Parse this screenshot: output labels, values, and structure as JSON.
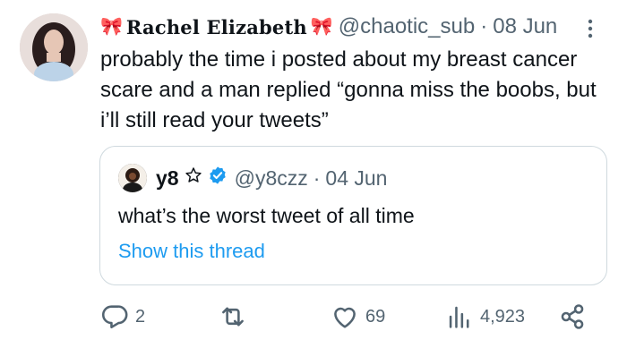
{
  "post": {
    "display_name": "Rachel Elizabeth",
    "handle": "@chaotic_sub",
    "date": "08 Jun",
    "separator": "·",
    "text": "probably the time i posted about my breast cancer scare and a man replied “gonna miss the boobs, but i’ll still read your tweets”"
  },
  "quoted": {
    "display_name": "y8",
    "handle": "@y8czz",
    "date": "04 Jun",
    "separator": "·",
    "text": "what’s the worst tweet of all time",
    "show_thread": "Show this thread"
  },
  "actions": {
    "replies": "2",
    "likes": "69",
    "views": "4,923"
  },
  "icons": {
    "bow": "bow-emoji",
    "star": "star-outline-icon",
    "verified": "verified-badge-icon",
    "more": "more-vertical-icon",
    "reply": "reply-icon",
    "retweet": "retweet-icon",
    "like": "heart-icon",
    "views": "views-chart-icon",
    "share": "share-icon"
  },
  "colors": {
    "text": "#0f1419",
    "muted": "#536471",
    "link": "#1d9bf0",
    "border": "#cfd9de",
    "bow": "#e0245e"
  }
}
